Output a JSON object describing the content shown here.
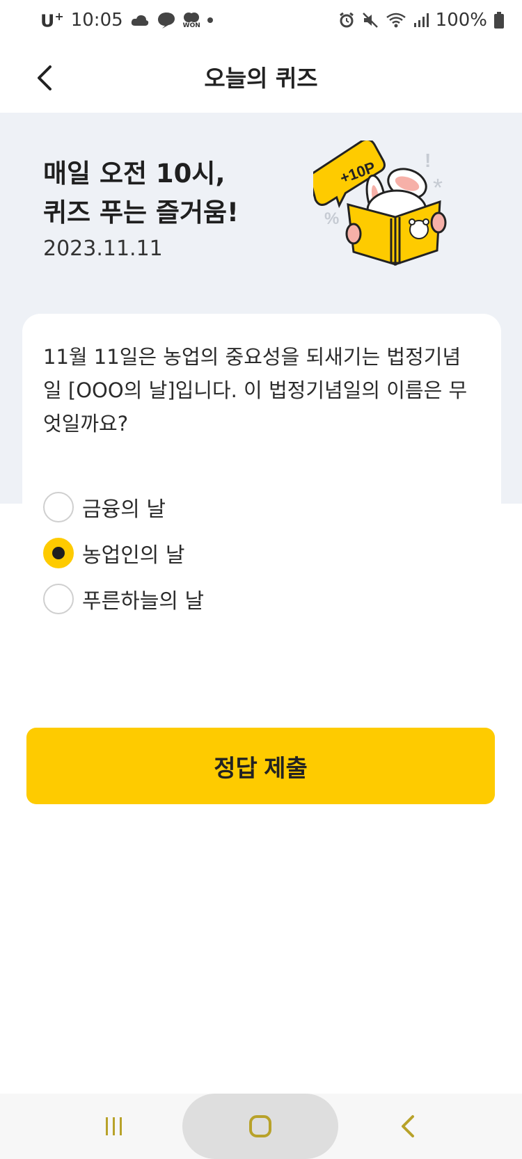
{
  "status_bar": {
    "carrier": "U",
    "carrier_plus": "+",
    "time": "10:05",
    "battery": "100%",
    "icons_left": [
      "cloud-icon",
      "chat-bubble-icon",
      "won-icon",
      "dot-icon"
    ],
    "icons_right": [
      "alarm-icon",
      "mute-icon",
      "wifi-icon",
      "signal-icon",
      "battery-icon"
    ],
    "won_label": "WON"
  },
  "header": {
    "title": "오늘의 퀴즈",
    "back_icon": "chevron-left-icon"
  },
  "hero": {
    "title_line1": "매일 오전 10시,",
    "title_line2": "퀴즈 푸는 즐거움!",
    "date": "2023.11.11",
    "badge": "+10P"
  },
  "quiz": {
    "question": "11월 11일은 농업의 중요성을 되새기는 법정기념일 [OOO의 날]입니다. 이 법정기념일의 이름은 무엇일까요?",
    "options": [
      {
        "label": "금융의 날",
        "selected": false
      },
      {
        "label": "농업인의 날",
        "selected": true
      },
      {
        "label": "푸른하늘의 날",
        "selected": false
      }
    ],
    "submit_label": "정답 제출"
  },
  "colors": {
    "accent": "#fecb00",
    "hero_bg": "#eef1f6",
    "nav_icon": "#b8a22a"
  },
  "navbar": {
    "icons": [
      "recent-apps-icon",
      "home-icon",
      "back-icon"
    ]
  }
}
